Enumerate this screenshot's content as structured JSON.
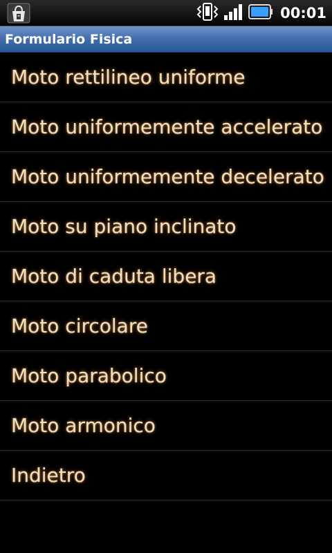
{
  "status_bar": {
    "time": "00:01",
    "icons": [
      "shopping-bag-notification-icon",
      "vibrate-icon",
      "signal-icon",
      "battery-icon"
    ],
    "battery_color": "#3aa0ff"
  },
  "app": {
    "title": "Formulario Fisica",
    "title_bar_color": "#3e6aa9"
  },
  "menu": {
    "items": [
      {
        "label": "Moto rettilineo uniforme"
      },
      {
        "label": "Moto uniformemente accelerato"
      },
      {
        "label": "Moto uniformemente decelerato"
      },
      {
        "label": "Moto su piano inclinato"
      },
      {
        "label": "Moto di caduta libera"
      },
      {
        "label": "Moto circolare"
      },
      {
        "label": "Moto parabolico"
      },
      {
        "label": "Moto armonico"
      },
      {
        "label": "Indietro"
      }
    ],
    "text_color": "#f6dfbe"
  }
}
